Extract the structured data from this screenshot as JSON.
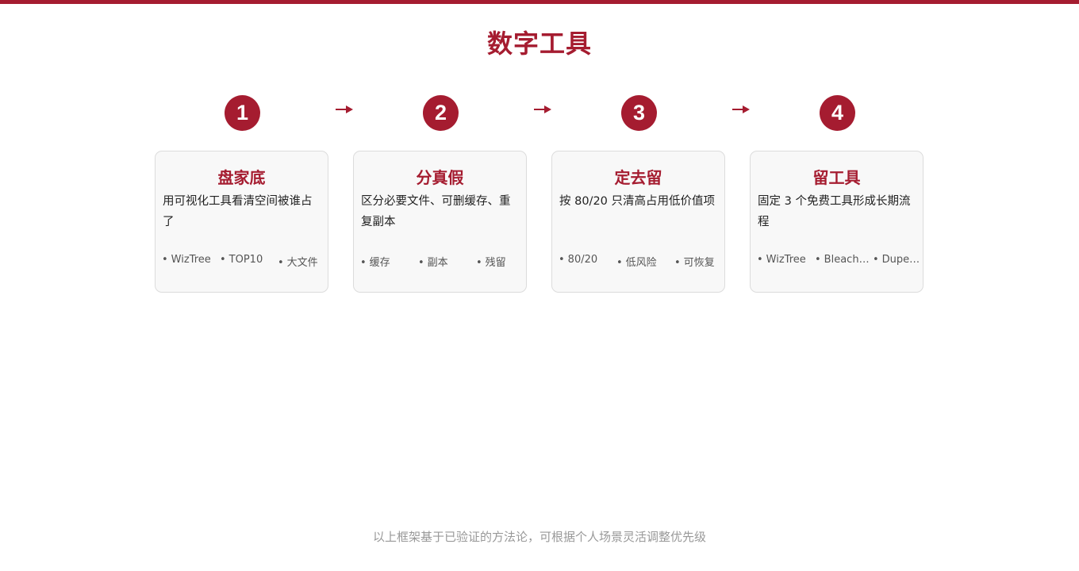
{
  "header": {
    "title": "数字工具"
  },
  "theme": {
    "accent": "#a51c30",
    "card_bg": "#f8f8f8",
    "card_border": "#dcdcdc"
  },
  "steps": [
    {
      "number": "1",
      "title": "盘家底",
      "description": "用可视化工具看清空间被谁占了",
      "tags": [
        "WizTree",
        "TOP10",
        "大文件"
      ]
    },
    {
      "number": "2",
      "title": "分真假",
      "description": "区分必要文件、可删缓存、重复副本",
      "tags": [
        "缓存",
        "副本",
        "残留"
      ]
    },
    {
      "number": "3",
      "title": "定去留",
      "description": "按 80/20 只清高占用低价值项",
      "tags": [
        "80/20",
        "低风险",
        "可恢复"
      ]
    },
    {
      "number": "4",
      "title": "留工具",
      "description": "固定 3 个免费工具形成长期流程",
      "tags": [
        "WizTree",
        "BleachBit",
        "DupeGuru"
      ]
    }
  ],
  "footer": {
    "note": "以上框架基于已验证的方法论，可根据个人场景灵活调整优先级"
  }
}
